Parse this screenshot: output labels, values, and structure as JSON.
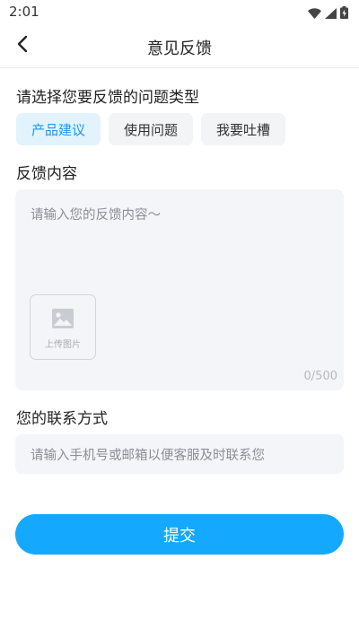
{
  "status_bar": {
    "time": "2:01",
    "icons": [
      "wifi-icon",
      "signal-icon",
      "battery-charging-icon"
    ]
  },
  "header": {
    "title": "意见反馈",
    "back_icon": "chevron-left-icon"
  },
  "feedback_type": {
    "label": "请选择您要反馈的问题类型",
    "options": [
      "产品建议",
      "使用问题",
      "我要吐槽"
    ],
    "selected": "产品建议"
  },
  "content": {
    "label": "反馈内容",
    "placeholder": "请输入您的反馈内容～",
    "upload_label": "上传图片",
    "upload_icon": "image-icon",
    "counter": "0/500"
  },
  "contact": {
    "label": "您的联系方式",
    "placeholder": "请输入手机号或邮箱以便客服及时联系您"
  },
  "submit": {
    "label": "提交"
  },
  "colors": {
    "accent": "#14a9ff",
    "chip_active_bg": "#e3f3fe",
    "chip_active_text": "#1b97f2",
    "field_bg": "#f4f5f8"
  }
}
